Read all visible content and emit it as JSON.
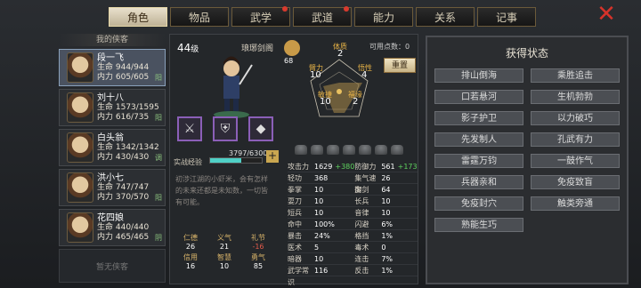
{
  "tabs": [
    {
      "label": "角色",
      "active": true,
      "dot": false
    },
    {
      "label": "物品",
      "active": false,
      "dot": false
    },
    {
      "label": "武学",
      "active": false,
      "dot": true
    },
    {
      "label": "武道",
      "active": false,
      "dot": true
    },
    {
      "label": "能力",
      "active": false,
      "dot": false
    },
    {
      "label": "关系",
      "active": false,
      "dot": false
    },
    {
      "label": "记事",
      "active": false,
      "dot": false
    }
  ],
  "roster": {
    "title": "我的侠客",
    "heroes": [
      {
        "name": "段一飞",
        "hp": "生命 944/944",
        "mp": "内力 605/605",
        "tag": "阳"
      },
      {
        "name": "刘十八",
        "hp": "生命 1573/1595",
        "mp": "内力 616/735",
        "tag": "阳"
      },
      {
        "name": "白头翁",
        "hp": "生命 1342/1342",
        "mp": "内力 430/430",
        "tag": "调"
      },
      {
        "name": "洪小七",
        "hp": "生命 747/747",
        "mp": "内力 370/570",
        "tag": "阳"
      },
      {
        "name": "花四娘",
        "hp": "生命 440/440",
        "mp": "内力 465/465",
        "tag": "阴"
      }
    ],
    "empty_label": "暂无侠客"
  },
  "profile": {
    "level": "44",
    "level_unit": "级",
    "org": "琅琊剑阁",
    "rank_num": "68",
    "exp_label": "实战经验",
    "exp_value": "3797/6300",
    "exp_fraction": 0.603,
    "desc": "初涉江湖的小虾米，会有怎样的未来还都是未知数，一切皆有可能。",
    "points": "可用点数：0",
    "reset": "重置"
  },
  "attrs": {
    "tizhi": {
      "k": "体质",
      "v": "2"
    },
    "biil": {
      "k": "臂力",
      "v": "10"
    },
    "wuxing": {
      "k": "悟性",
      "v": "4"
    },
    "minjie": {
      "k": "敏捷",
      "v": "10"
    },
    "fuyuan": {
      "k": "福缘",
      "v": "2"
    }
  },
  "virtues": [
    {
      "k": "仁德",
      "v": "26",
      "neg": false
    },
    {
      "k": "义气",
      "v": "21",
      "neg": false
    },
    {
      "k": "礼节",
      "v": "-16",
      "neg": true
    },
    {
      "k": "信用",
      "v": "16",
      "neg": false
    },
    {
      "k": "智慧",
      "v": "10",
      "neg": false
    },
    {
      "k": "勇气",
      "v": "85",
      "neg": false
    }
  ],
  "stats": [
    {
      "k": "攻击力",
      "v": "1629",
      "b": "+380"
    },
    {
      "k": "防御力",
      "v": "561",
      "b": "+173"
    },
    {
      "k": "轻功",
      "v": "368",
      "b": ""
    },
    {
      "k": "集气速度",
      "v": "26",
      "b": ""
    },
    {
      "k": "拳掌",
      "v": "10",
      "b": ""
    },
    {
      "k": "御剑",
      "v": "64",
      "b": ""
    },
    {
      "k": "耍刀",
      "v": "10",
      "b": ""
    },
    {
      "k": "长兵",
      "v": "10",
      "b": ""
    },
    {
      "k": "短兵",
      "v": "10",
      "b": ""
    },
    {
      "k": "音律",
      "v": "10",
      "b": ""
    },
    {
      "k": "命中",
      "v": "100%",
      "b": ""
    },
    {
      "k": "闪避",
      "v": "6%",
      "b": ""
    },
    {
      "k": "暴击",
      "v": "24%",
      "b": ""
    },
    {
      "k": "格挡",
      "v": "1%",
      "b": ""
    },
    {
      "k": "医术",
      "v": "5",
      "b": ""
    },
    {
      "k": "毒术",
      "v": "0",
      "b": ""
    },
    {
      "k": "暗器",
      "v": "10",
      "b": ""
    },
    {
      "k": "连击",
      "v": "7%",
      "b": ""
    },
    {
      "k": "武学常识",
      "v": "116",
      "b": ""
    },
    {
      "k": "反击",
      "v": "1%",
      "b": ""
    }
  ],
  "buffs": {
    "title": "获得状态",
    "items": [
      "排山倒海",
      "乘胜追击",
      "口若悬河",
      "生机勃勃",
      "影子护卫",
      "以力破巧",
      "先发制人",
      "孔武有力",
      "雷霆万钧",
      "一鼓作气",
      "兵器亲和",
      "免疫致盲",
      "免疫封穴",
      "触类旁通",
      "熟能生巧"
    ]
  }
}
